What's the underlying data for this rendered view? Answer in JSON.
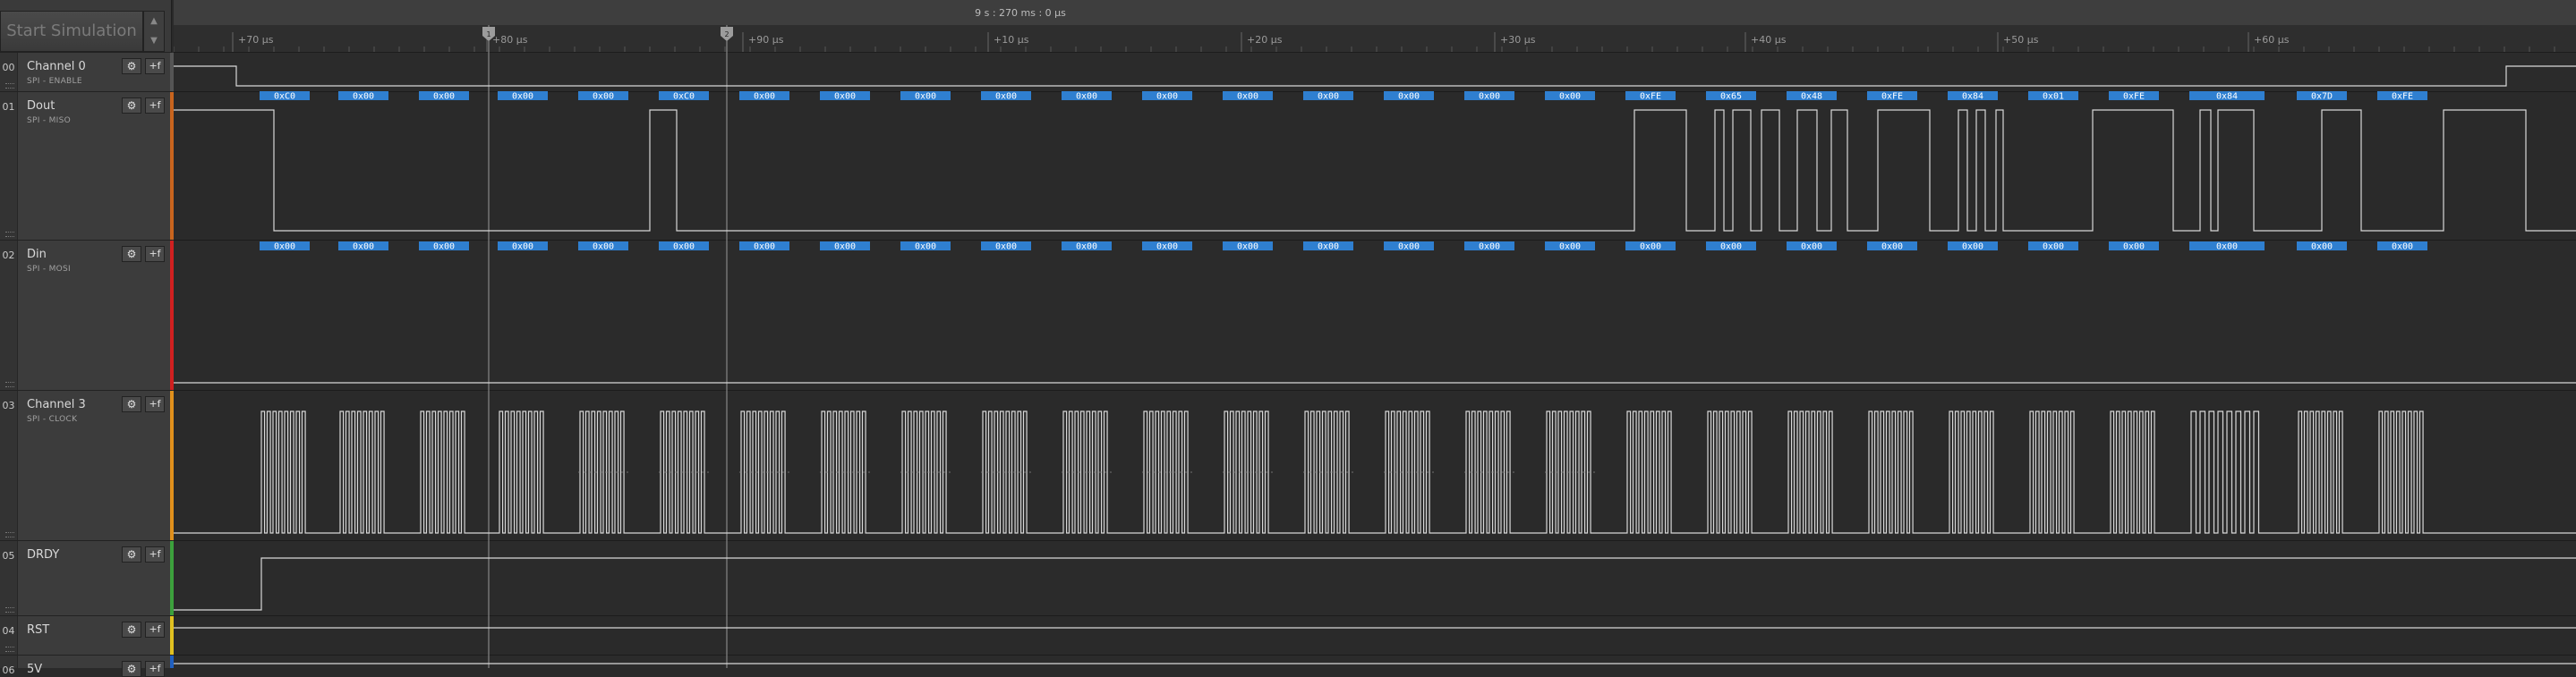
{
  "app": {
    "start_simulation_label": "Start Simulation",
    "stepper_up": "▲",
    "stepper_down": "▼",
    "time_readout": "9 s : 270 ms : 0 µs"
  },
  "ruler": {
    "ticks": [
      "+70 µs",
      "+80 µs",
      "+90 µs",
      "+10 µs",
      "+20 µs",
      "+30 µs",
      "+40 µs",
      "+50 µs",
      "+60 µs"
    ]
  },
  "markers": {
    "marker1": "1",
    "marker2": "2"
  },
  "channels": [
    {
      "num": "00",
      "name": "Channel 0",
      "protocol": "SPI - ENABLE",
      "color": "#555555",
      "gear": "⚙",
      "fn": "+f"
    },
    {
      "num": "01",
      "name": "Dout",
      "protocol": "SPI - MISO",
      "color": "#c8641e",
      "gear": "⚙",
      "fn": "+f"
    },
    {
      "num": "02",
      "name": "Din",
      "protocol": "SPI - MOSI",
      "color": "#d02020",
      "gear": "⚙",
      "fn": "+f"
    },
    {
      "num": "03",
      "name": "Channel 3",
      "protocol": "SPI - CLOCK",
      "color": "#e0901c",
      "gear": "⚙",
      "fn": "+f"
    },
    {
      "num": "05",
      "name": "DRDY",
      "protocol": "",
      "color": "#3ca03c",
      "gear": "⚙",
      "fn": "+f"
    },
    {
      "num": "04",
      "name": "RST",
      "protocol": "",
      "color": "#e0c020",
      "gear": "⚙",
      "fn": "+f"
    },
    {
      "num": "06",
      "name": "5V",
      "protocol": "",
      "color": "#2060c0",
      "gear": "⚙",
      "fn": "+f"
    }
  ],
  "bytes": {
    "miso": [
      "0xC0",
      "0x00",
      "0x00",
      "0x00",
      "0x00",
      "0xC0",
      "0x00",
      "0x00",
      "0x00",
      "0x00",
      "0x00",
      "0x00",
      "0x00",
      "0x00",
      "0x00",
      "0x00",
      "0x00",
      "0xFE",
      "0x65",
      "0x48",
      "0xFE",
      "0x84",
      "0x01",
      "0xFE",
      "0x84",
      "0x7D",
      "0xFE"
    ],
    "mosi": [
      "0x00",
      "0x00",
      "0x00",
      "0x00",
      "0x00",
      "0x00",
      "0x00",
      "0x00",
      "0x00",
      "0x00",
      "0x00",
      "0x00",
      "0x00",
      "0x00",
      "0x00",
      "0x00",
      "0x00",
      "0x00",
      "0x00",
      "0x00",
      "0x00",
      "0x00",
      "0x00",
      "0x00",
      "0x00",
      "0x00",
      "0x00"
    ]
  },
  "colors": {
    "bubble": "#2f7fd0",
    "trace": "#d8d8d8",
    "background": "#2a2a2a",
    "grid": "#3a3a3a",
    "cursor": "#9a9a9a"
  }
}
